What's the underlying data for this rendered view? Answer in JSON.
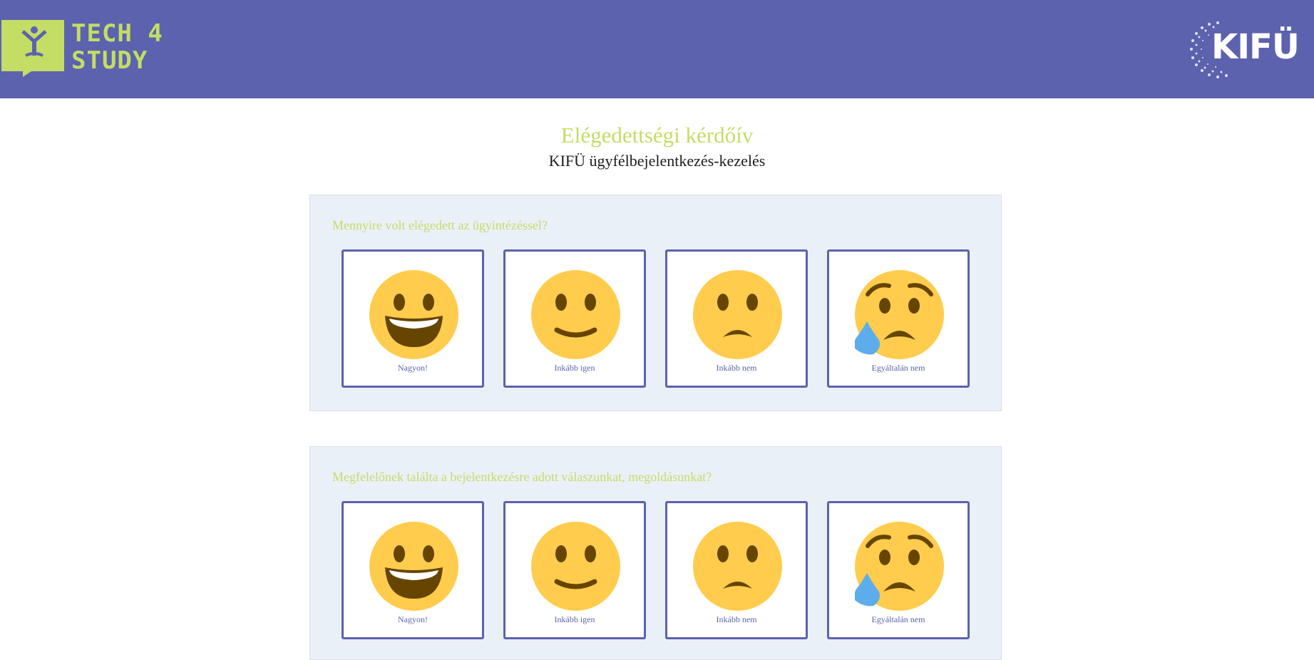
{
  "header": {
    "brand_left_line1": "TECH 4",
    "brand_left_line2": "STUDY",
    "brand_right": "KIFÜ",
    "background_color": "#5c62ad",
    "accent_color": "#c3dd65"
  },
  "page": {
    "title": "Elégedettségi kérdőív",
    "subtitle": "KIFÜ ügyfélbejelentkezés-kezelés"
  },
  "questions": [
    {
      "text": "Mennyire volt elégedett az ügyintézéssel?",
      "options": [
        {
          "label": "Nagyon!",
          "icon": "grinning-face-icon"
        },
        {
          "label": "Inkább igen",
          "icon": "slightly-smiling-face-icon"
        },
        {
          "label": "Inkább nem",
          "icon": "frowning-face-icon"
        },
        {
          "label": "Egyáltalán nem",
          "icon": "sad-tear-face-icon"
        }
      ]
    },
    {
      "text": "Megfelelőnek találta a bejelentkezésre adott válaszunkat, megoldásunkat?",
      "options": [
        {
          "label": "Nagyon!",
          "icon": "grinning-face-icon"
        },
        {
          "label": "Inkább igen",
          "icon": "slightly-smiling-face-icon"
        },
        {
          "label": "Inkább nem",
          "icon": "frowning-face-icon"
        },
        {
          "label": "Egyáltalán nem",
          "icon": "sad-tear-face-icon"
        }
      ]
    }
  ]
}
